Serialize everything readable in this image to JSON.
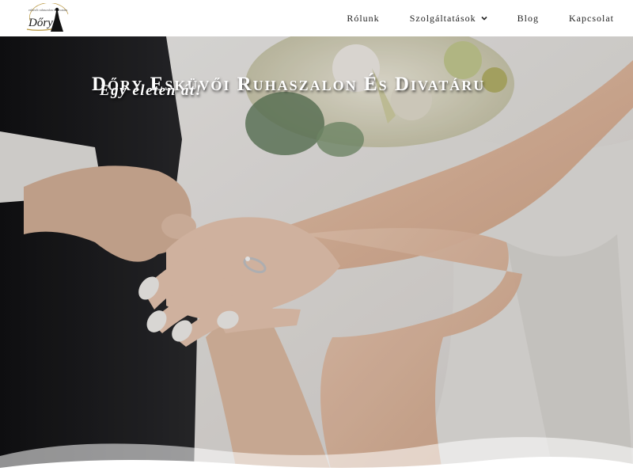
{
  "logo": {
    "wordmark": "Dőry",
    "arc_text": "esküvői ruhaszalon és divatáru",
    "icon": "bride-silhouette-icon"
  },
  "nav": {
    "items": [
      {
        "label": "Rólunk"
      },
      {
        "label": "Szolgáltatások",
        "dropdown_icon": "chevron-down-icon"
      },
      {
        "label": "Blog"
      },
      {
        "label": "Kapcsolat"
      }
    ]
  },
  "hero": {
    "title": "Dőry Esküvői Ruhaszalon És Divatáru",
    "subtitle": "Egy életen át!"
  },
  "colors": {
    "header_bg": "#ffffff",
    "nav_text": "#222222",
    "logo_gold": "#b8963e",
    "hero_text": "#ffffff",
    "suit_dark": "#1b1b1d",
    "dress_white": "#efecea",
    "skin": "#e7c3ab"
  }
}
